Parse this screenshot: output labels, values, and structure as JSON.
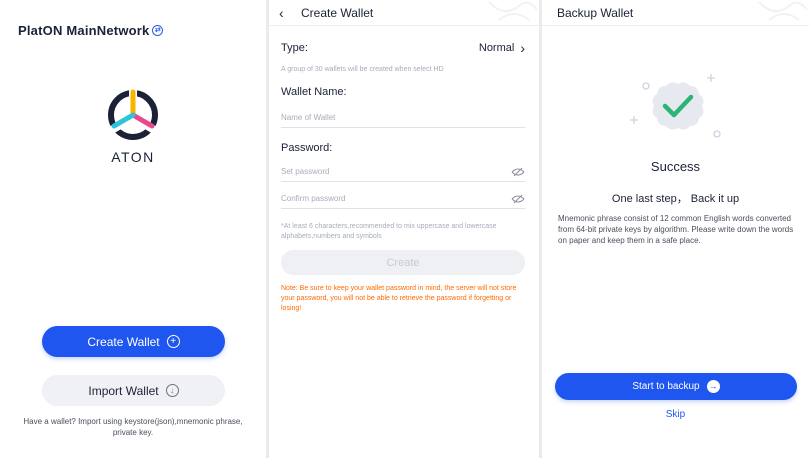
{
  "colors": {
    "accent": "#1f56f0",
    "warning": "#ff6b00",
    "hint": "#a7acbb",
    "success_check": "#2bb573",
    "logo_yellow": "#f7b500",
    "logo_pink": "#e9488f",
    "logo_cyan": "#2fc3d7",
    "logo_navy": "#1b2137"
  },
  "welcome": {
    "network_title": "PlatON MainNetwork",
    "network_icon": "switch-icon",
    "brand": "ATON",
    "create_button": "Create Wallet",
    "create_icon": "plus-circle-icon",
    "import_button": "Import Wallet",
    "import_icon": "download-circle-icon",
    "import_hint": "Have a wallet? Import using keystore(json),mnemonic phrase, private key."
  },
  "create_wallet": {
    "title": "Create Wallet",
    "type_label": "Type:",
    "type_value": "Normal",
    "type_hint": "A group of 30 wallets will be created when select HD",
    "name_label": "Wallet Name:",
    "name_placeholder": "Name of Wallet",
    "password_label": "Password:",
    "password_placeholder": "Set password",
    "confirm_placeholder": "Confirm password",
    "password_hint": "*At least 6 characters,recommended to mix uppercase and lowercase alphabets,numbers and symbols",
    "submit_button": "Create",
    "warning": "Note: Be sure to keep your wallet password in mind, the server will not store your password, you will not be able to retrieve the password if forgetting or losing!"
  },
  "backup_wallet": {
    "title": "Backup Wallet",
    "success_title": "Success",
    "subtitle": "One last step， Back it up",
    "description": "Mnemonic phrase consist of 12 common English words converted from 64-bit private keys by algorithm. Please write down the words on paper and keep them in a safe place.",
    "start_button": "Start to backup",
    "start_icon": "arrow-right-circle-icon",
    "skip_link": "Skip"
  }
}
